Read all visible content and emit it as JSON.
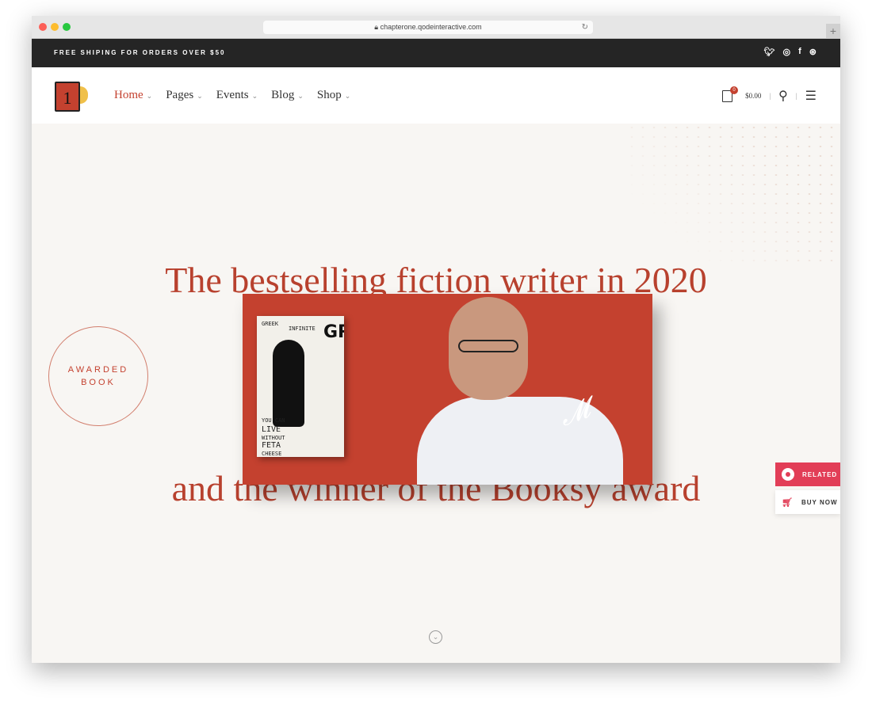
{
  "browser": {
    "url": "chapterone.qodeinteractive.com"
  },
  "topbar": {
    "shipping": "FREE SHIPING FOR ORDERS OVER $50",
    "social": [
      "twitter-icon",
      "instagram-icon",
      "facebook-icon",
      "dribbble-icon"
    ]
  },
  "header": {
    "logo_text": "1",
    "nav": [
      {
        "label": "Home",
        "active": true
      },
      {
        "label": "Pages"
      },
      {
        "label": "Events"
      },
      {
        "label": "Blog"
      },
      {
        "label": "Shop"
      }
    ],
    "cart_count": "0",
    "cart_total": "$0.00"
  },
  "hero": {
    "line1": "The bestselling fiction writer in 2020",
    "line2": "and the winner of the Booksy award",
    "badge_line1": "AWARDED",
    "badge_line2": "BOOK",
    "book_title": "GREECE",
    "book_texts": [
      "GREEK",
      "INFINITE",
      "YOU CAN",
      "LIVE",
      "WITHOUT",
      "FETA",
      "CHEESE"
    ]
  },
  "side": {
    "related": "RELATED",
    "buy": "BUY NOW"
  },
  "colors": {
    "accent": "#c4412f",
    "related": "#e23e57",
    "topbar": "#252525"
  }
}
